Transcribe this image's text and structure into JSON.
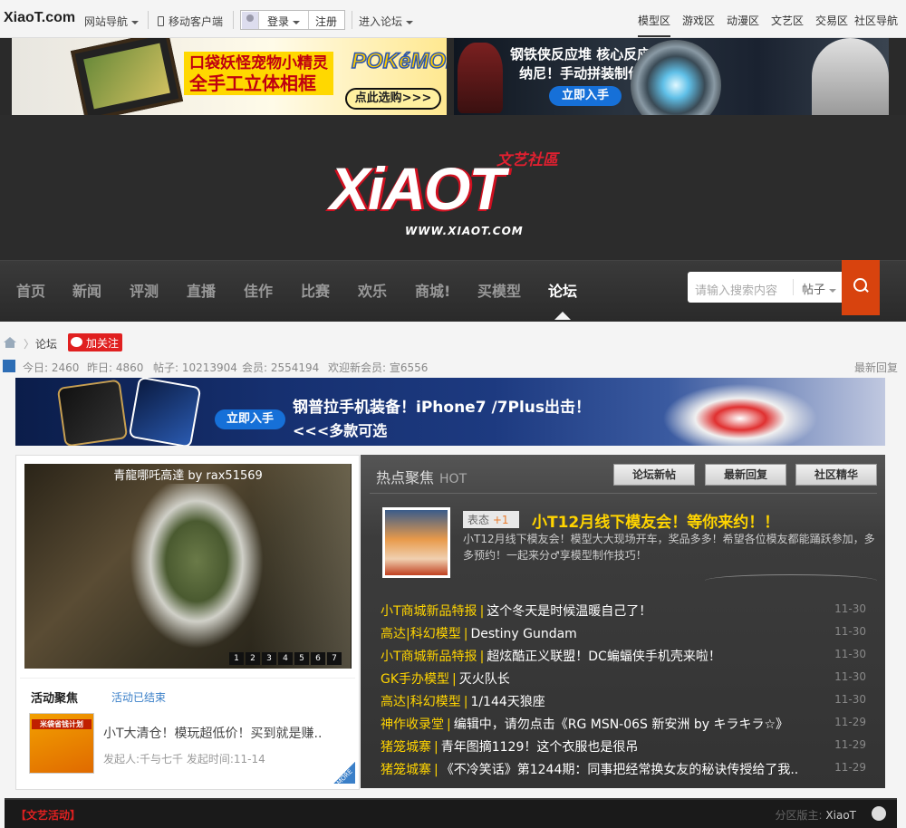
{
  "topbar": {
    "logo": "XiaoT.com",
    "site_nav": "网站导航",
    "mobile": "移动客户端",
    "login": "登录",
    "register": "注册",
    "enter_forum": "进入论坛",
    "zones": [
      "模型区",
      "游戏区",
      "动漫区",
      "文艺区",
      "交易区",
      "社区导航"
    ]
  },
  "banners": {
    "b1_line1": "口袋妖怪宠物小精灵",
    "b1_line2": "全手工立体相框",
    "b1_brand": "POKéMON",
    "b1_cta": "点此选购>>>",
    "b2_line1": "钢铁侠反应堆 核心反应炉",
    "b2_line2": "纳尼！手动拼装制作！",
    "b2_cta": "立即入手",
    "b3_title": "钢普拉手机装备！iPhone7 /7Plus出击！",
    "b3_sub": "<<<多款可选",
    "b3_cta": "立即入手"
  },
  "header": {
    "logo_text": "XiAOT",
    "logo_tag": "文艺社區",
    "logo_url": "WWW.XIAOT.COM"
  },
  "nav": {
    "items": [
      "首页",
      "新闻",
      "评测",
      "直播",
      "佳作",
      "比赛",
      "欢乐",
      "商城!",
      "买模型",
      "论坛"
    ],
    "search_placeholder": "请输入搜索内容",
    "search_type": "帖子"
  },
  "breadcrumb": {
    "forum": "论坛",
    "follow": "加关注"
  },
  "stats": {
    "today": "今日: 2460",
    "yesterday": "昨日: 4860",
    "posts": "帖子: 10213904",
    "members": "会员: 2554194",
    "welcome": "欢迎新会员: 宣6556",
    "latest": "最新回复"
  },
  "slider": {
    "caption": "青龍哪吒高達 by rax51569",
    "pages": [
      "1",
      "2",
      "3",
      "4",
      "5",
      "6",
      "7"
    ]
  },
  "activity": {
    "title": "活动聚焦",
    "status": "活动已结束",
    "thumb_label": "米袋省钱计划",
    "item_title": "小T大清仓！模玩超低价！买到就是赚..",
    "meta": "发起人:千与七千   发起时间:11-14",
    "more": "MORE"
  },
  "hot": {
    "title": "热点聚焦",
    "title_en": "HOT",
    "buttons": [
      "论坛新帖",
      "最新回复",
      "社区精华"
    ],
    "feature": {
      "tag": "表态",
      "tag_count": "+1",
      "title": "小T12月线下模友会！等你来约！！",
      "desc": "小T12月线下模友会！模型大大现场开车，奖品多多！希望各位模友都能踊跃参加，多多预约！一起来分♂享模型制作技巧！"
    },
    "rows": [
      {
        "cat": "小T商城新品特报",
        "title": "这个冬天是时候温暖自己了！",
        "date": "11-30"
      },
      {
        "cat": "高达|科幻模型",
        "title": "Destiny Gundam",
        "date": "11-30"
      },
      {
        "cat": "小T商城新品特报",
        "title": "超炫酷正义联盟！DC蝙蝠侠手机壳来啦！",
        "date": "11-30"
      },
      {
        "cat": "GK手办模型",
        "title": "灭火队长",
        "date": "11-30"
      },
      {
        "cat": "高达|科幻模型",
        "title": "1/144天狼座",
        "date": "11-30"
      },
      {
        "cat": "神作收录堂",
        "title": "编辑中，请勿点击《RG MSN-06S 新安洲 by キラキラ☆》",
        "date": "11-29"
      },
      {
        "cat": "猪笼城寨",
        "title": "青年图摘1129！这个衣服也是很吊",
        "date": "11-29"
      },
      {
        "cat": "猪笼城寨",
        "title": "《不冷笑话》第1244期：同事把经常换女友的秘诀传授给了我..",
        "date": "11-29"
      }
    ]
  },
  "footer": {
    "section": "【文艺活动】",
    "moderator_label": "分区版主:",
    "moderator": "XiaoT"
  }
}
